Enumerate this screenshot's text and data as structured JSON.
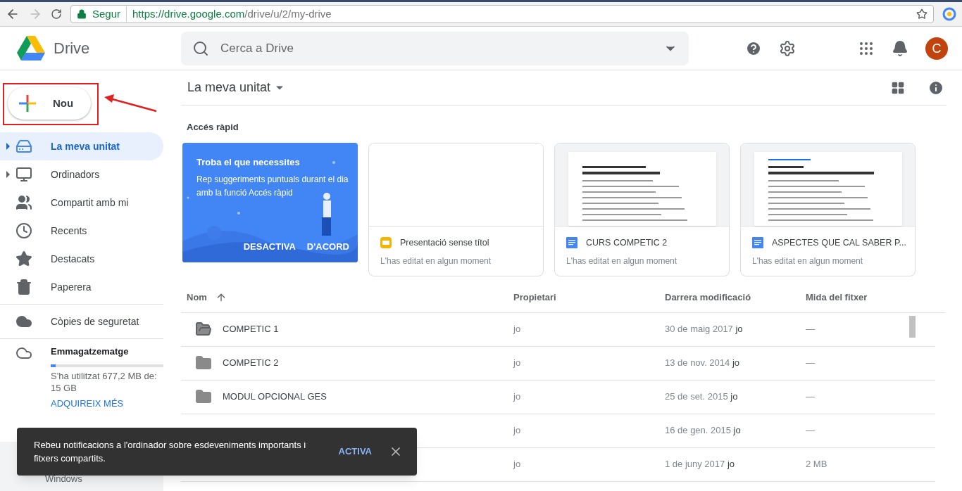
{
  "browser": {
    "secure_label": "Segur",
    "url_host": "https://drive.google.com",
    "url_path": "/drive/u/2/my-drive"
  },
  "app": {
    "name": "Drive",
    "search_placeholder": "Cerca a Drive",
    "avatar": "C"
  },
  "new_button": {
    "label": "Nou"
  },
  "sidebar": {
    "items": [
      {
        "label": "La meva unitat",
        "kind": "drive",
        "expandable": true,
        "selected": true
      },
      {
        "label": "Ordinadors",
        "kind": "computers",
        "expandable": true,
        "selected": false
      },
      {
        "label": "Compartit amb mi",
        "kind": "people",
        "expandable": false,
        "selected": false
      },
      {
        "label": "Recents",
        "kind": "clock",
        "expandable": false,
        "selected": false
      },
      {
        "label": "Destacats",
        "kind": "star",
        "expandable": false,
        "selected": false
      },
      {
        "label": "Paperera",
        "kind": "trash",
        "expandable": false,
        "selected": false
      }
    ],
    "backup": {
      "label": "Còpies de seguretat"
    },
    "storage": {
      "title": "Emmagatzematge",
      "level": 0.045,
      "usage": "S'ha utilitzat 677,2 MB de: 15 GB",
      "link": "ADQUIREIX MÉS"
    },
    "download": {
      "label": "Windows"
    }
  },
  "location": {
    "title": "La meva unitat"
  },
  "quick_access": {
    "title": "Accés ràpid",
    "tip": {
      "title": "Troba el que necessites",
      "body": "Rep suggeriments puntuals durant el dia amb la funció Accés ràpid",
      "buttons": [
        "DESACTIVA",
        "D'ACORD"
      ]
    },
    "cards": [
      {
        "kind": "slides",
        "title": "Presentació sense títol",
        "subtitle": "L'has editat en algun moment"
      },
      {
        "kind": "doc",
        "title": "CURS COMPETIC 2",
        "subtitle": "L'has editat en algun moment"
      },
      {
        "kind": "doc",
        "title": "ASPECTES QUE CAL SABER P...",
        "subtitle": "L'has editat en algun moment"
      }
    ]
  },
  "table": {
    "columns": [
      "Nom",
      "Propietari",
      "Darrera modificació",
      "Mida del fitxer"
    ],
    "rows": [
      {
        "kind": "shared-folder",
        "name": "COMPETIC 1",
        "owner": "jo",
        "modified": "30 de maig 2017",
        "modified_by": "jo",
        "size": "—"
      },
      {
        "kind": "folder",
        "name": "COMPETIC 2",
        "owner": "jo",
        "modified": "13 de nov. 2014",
        "modified_by": "jo",
        "size": "—"
      },
      {
        "kind": "folder",
        "name": "MODUL OPCIONAL GES",
        "owner": "jo",
        "modified": "25 de set. 2015",
        "modified_by": "jo",
        "size": "—"
      },
      {
        "kind": "hidden",
        "owner": "jo",
        "modified": "16 de gen. 2015",
        "modified_by": "jo",
        "size": "—"
      },
      {
        "kind": "hidden",
        "owner": "jo",
        "modified": "1 de juny 2017",
        "modified_by": "jo",
        "size": "2 MB"
      }
    ]
  },
  "toast": {
    "message": "Rebeu notificacions a l'ordinador sobre esdeveniments importants i fitxers compartits.",
    "action": "ACTIVA"
  }
}
